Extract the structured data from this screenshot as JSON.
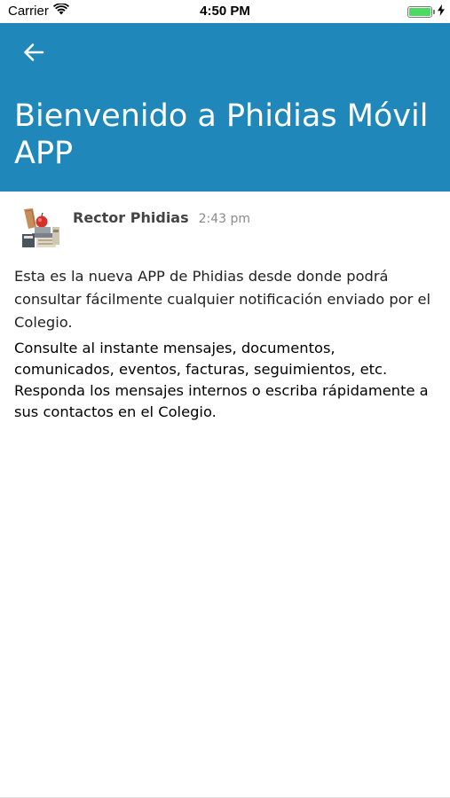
{
  "status_bar": {
    "carrier": "Carrier",
    "time": "4:50 PM",
    "wifi_icon": "wifi-icon",
    "battery_icon": "battery-icon",
    "charging_icon": "charging-bolt-icon",
    "battery_level": 1.0
  },
  "header": {
    "back_icon": "arrow-left-icon",
    "title": "Bienvenido a Phidias Móvil APP",
    "background_color": "#1f87b9"
  },
  "message": {
    "sender": "Rector Phidias",
    "time": "2:43 pm",
    "paragraphs": [
      "Esta es la nueva APP de Phidias desde donde podrá consultar fácilmente cualquier notificación enviado por el Colegio.",
      "Consulte al instante mensajes, documentos, comunicados, eventos, facturas, seguimientos, etc. Responda los mensajes internos o escriba rápidamente a sus contactos en el Colegio."
    ]
  }
}
